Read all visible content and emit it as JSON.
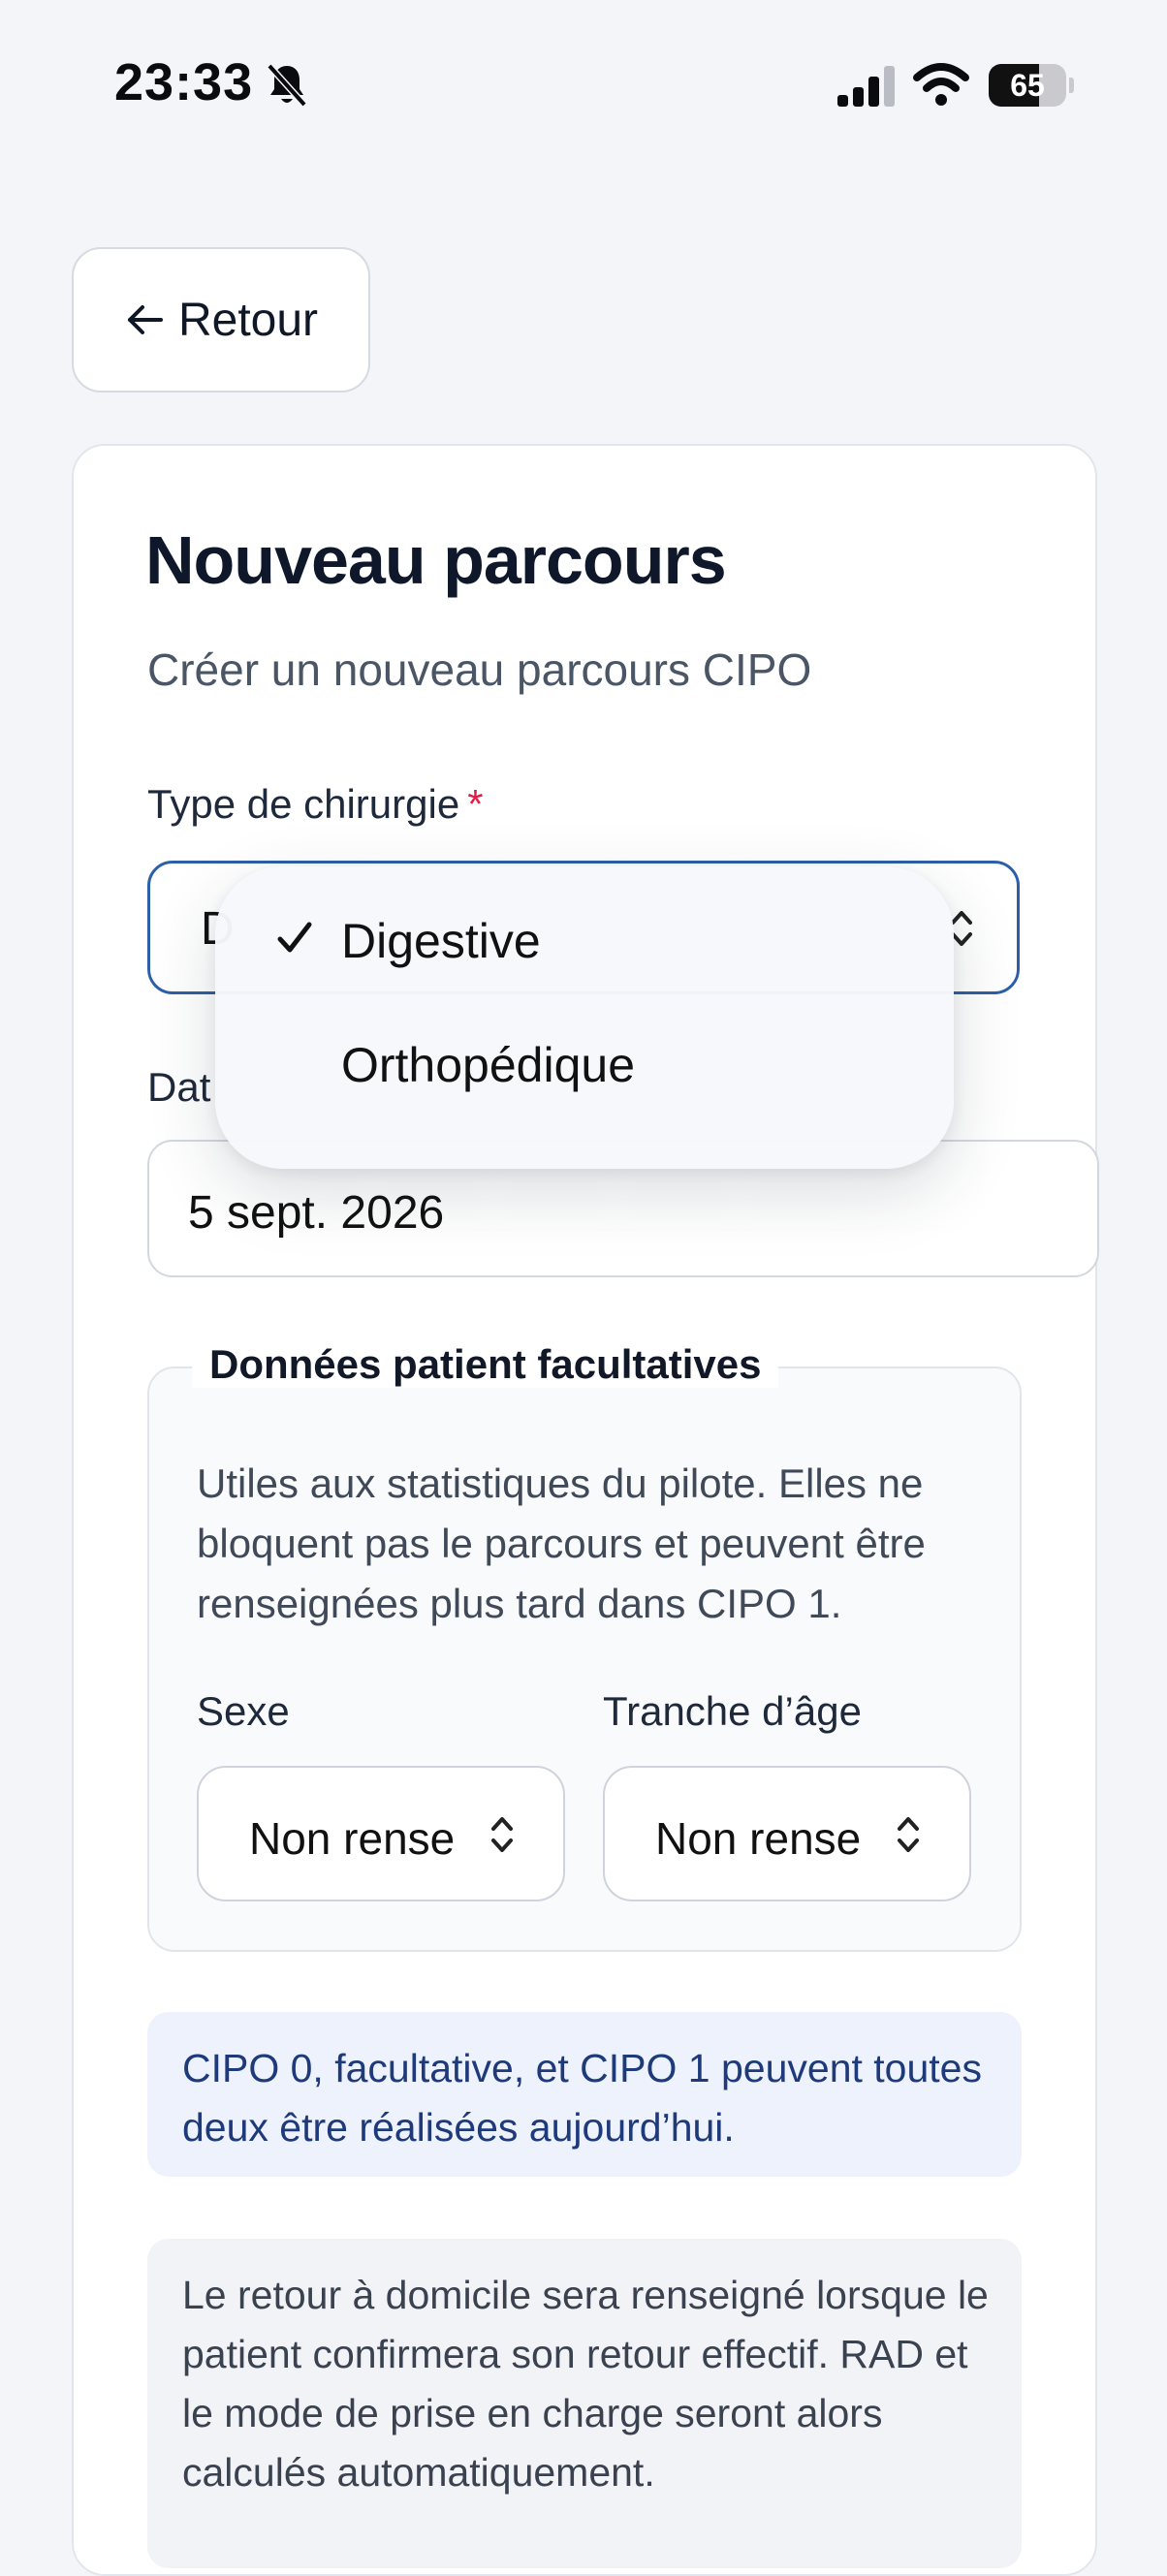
{
  "status_bar": {
    "time": "23:33",
    "battery_level": "65"
  },
  "back_button": {
    "label": "Retour"
  },
  "form": {
    "title": "Nouveau parcours",
    "subtitle": "Créer un nouveau parcours CIPO",
    "surgery_type": {
      "label": "Type de chirurgie",
      "required_mark": "*",
      "selected_visible_letter": "D",
      "options": [
        {
          "label": "Digestive",
          "selected": true
        },
        {
          "label": "Orthopédique",
          "selected": false
        }
      ]
    },
    "date": {
      "label_visible": "Dat",
      "value": "5 sept. 2026"
    },
    "optional_data": {
      "legend": "Données patient facultatives",
      "help": "Utiles aux statistiques du pilote. Elles ne bloquent pas le parcours et peuvent être renseignées plus tard dans CIPO 1.",
      "sex": {
        "label": "Sexe",
        "value": "Non rense"
      },
      "age_range": {
        "label": "Tranche d’âge",
        "value": "Non rense"
      }
    },
    "info_message": "CIPO 0, facultative, et CIPO 1 peuvent toutes deux être réalisées aujourd’hui.",
    "note_message": "Le retour à domicile sera renseigné lorsque le patient confirmera son retour effectif. RAD et le mode de prise en charge seront alors calculés automatiquement."
  },
  "colors": {
    "accent": "#2b5fa8",
    "required": "#e11d48",
    "info_bg": "#edf2fc",
    "info_text": "#1e3a7b"
  },
  "icons": [
    "bell-slash-icon",
    "signal-icon",
    "wifi-icon",
    "battery-icon",
    "arrow-left-icon",
    "chevron-updown-icon",
    "checkmark-icon"
  ]
}
